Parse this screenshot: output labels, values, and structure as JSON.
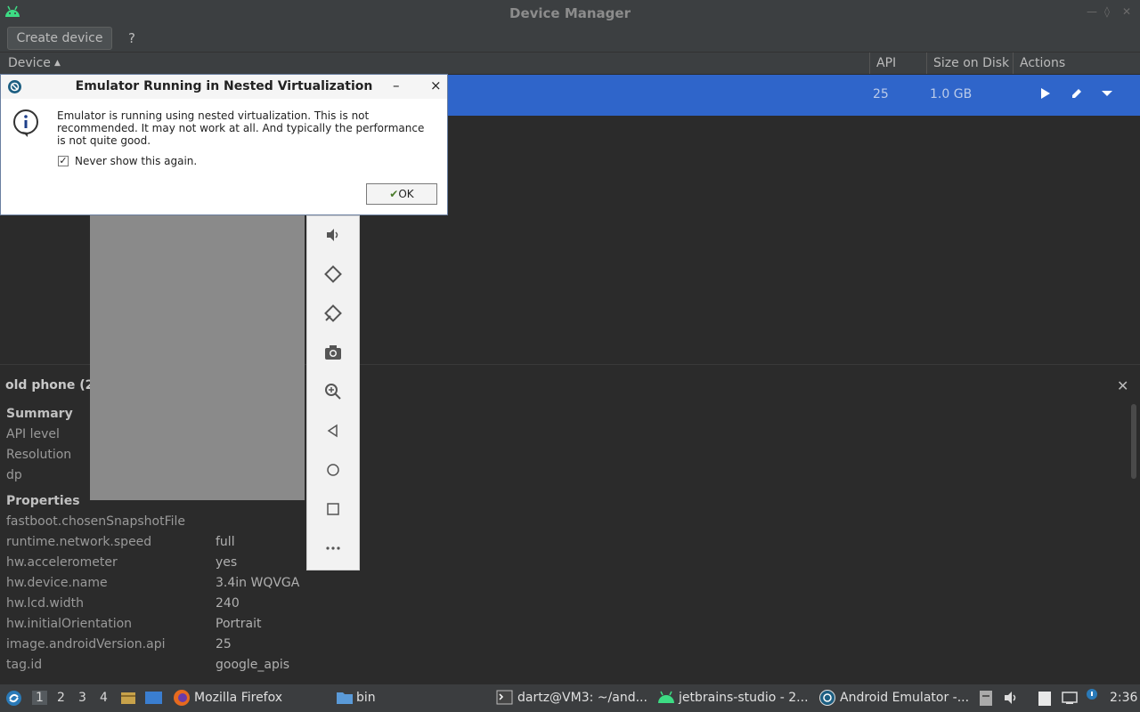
{
  "window": {
    "title": "Device Manager"
  },
  "toolbar": {
    "create_device": "Create device",
    "help": "?"
  },
  "table": {
    "columns": [
      "Device",
      "API",
      "Size on Disk",
      "Actions"
    ],
    "sort_indicator": "▲",
    "selected_row": {
      "api": "25",
      "size": "1.0 GB"
    }
  },
  "details": {
    "title": "old phone (2",
    "summary_heading": "Summary",
    "summary": [
      {
        "label": "API level"
      },
      {
        "label": "Resolution"
      },
      {
        "label": "dp"
      }
    ],
    "properties_heading": "Properties",
    "properties": [
      {
        "label": "fastboot.chosenSnapshotFile",
        "value": ""
      },
      {
        "label": "runtime.network.speed",
        "value": "full"
      },
      {
        "label": "hw.accelerometer",
        "value": "yes"
      },
      {
        "label": "hw.device.name",
        "value": "3.4in WQVGA"
      },
      {
        "label": "hw.lcd.width",
        "value": "240"
      },
      {
        "label": "hw.initialOrientation",
        "value": "Portrait"
      },
      {
        "label": "image.androidVersion.api",
        "value": "25"
      },
      {
        "label": "tag.id",
        "value": "google_apis"
      }
    ]
  },
  "dialog": {
    "title": "Emulator Running in Nested Virtualization",
    "message": "Emulator is running using nested virtualization. This is not recommended. It may not work at all. And typically the performance is not quite good.",
    "checkbox_label": "Never show this again.",
    "checkbox_checked": true,
    "ok": "OK",
    "minimize": "–",
    "close": "×"
  },
  "taskbar": {
    "workspaces": [
      "1",
      "2",
      "3",
      "4"
    ],
    "active_workspace": "1",
    "tasks": [
      {
        "label": "Mozilla Firefox",
        "icon": "firefox-icon"
      },
      {
        "label": "bin",
        "icon": "folder-icon"
      },
      {
        "label": "dartz@VM3: ~/and...",
        "icon": "terminal-icon"
      },
      {
        "label": "jetbrains-studio - 2...",
        "icon": "android-icon"
      },
      {
        "label": "Android Emulator -...",
        "icon": "emulator-icon"
      }
    ],
    "clock": "2:36"
  },
  "colors": {
    "selection": "#2f65ca",
    "panel": "#2b2b2b"
  }
}
